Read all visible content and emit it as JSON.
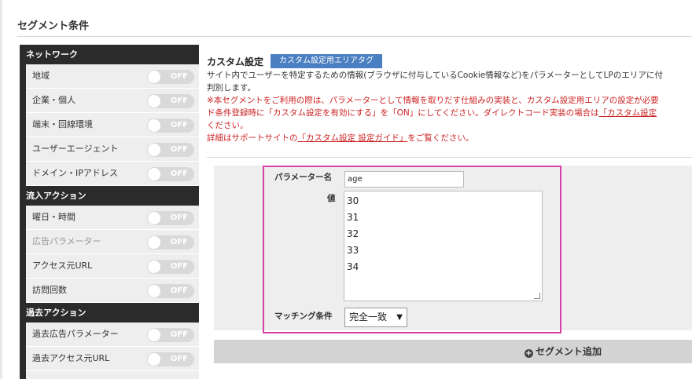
{
  "page": {
    "title": "セグメント条件"
  },
  "sidebar": {
    "toggle_state": "OFF",
    "groups": [
      {
        "heading": "ネットワーク",
        "items": [
          "地域",
          "企業・個人",
          "端末・回線環境",
          "ユーザーエージェント",
          "ドメイン・IPアドレス"
        ]
      },
      {
        "heading": "流入アクション",
        "items": [
          "曜日・時間",
          "広告パラメーター",
          "アクセス元URL",
          "訪問回数"
        ]
      },
      {
        "heading": "過去アクション",
        "items": [
          "過去広告パラメーター",
          "過去アクセス元URL"
        ]
      }
    ]
  },
  "main": {
    "title": "カスタム設定",
    "tag_button": "カスタム設定用エリアタグ",
    "desc_line1": "サイト内でユーザーを特定するための情報(ブラウザに付与しているCookie情報など)をパラメーターとしてLPのエリアに付",
    "desc_line2": "判別します。",
    "warn_line1": "※本セグメントをご利用の際は、パラメーターとして情報を取りだす仕組みの実装と、カスタム設定用エリアの設定が必要",
    "warn_line2_pre": "ド条件登録時に「カスタム設定を有効にする」を「ON」にしてください。ダイレクトコード実装の場合は",
    "warn_line2_link": "「カスタム設定",
    "warn_line3": "ください。",
    "guide_pre": "詳細はサポートサイトの",
    "guide_link": "「カスタム設定 設定ガイド」",
    "guide_post": "をご覧ください。"
  },
  "form": {
    "param_label": "パラメーター名",
    "param_value": "age",
    "value_label": "値",
    "values": [
      "30",
      "31",
      "32",
      "33",
      "34"
    ],
    "match_label": "マッチング条件",
    "match_selected": "完全一致",
    "match_arrow": "▼"
  },
  "add_button": {
    "label": "セグメント追加",
    "icon": "plus-circle-icon"
  }
}
